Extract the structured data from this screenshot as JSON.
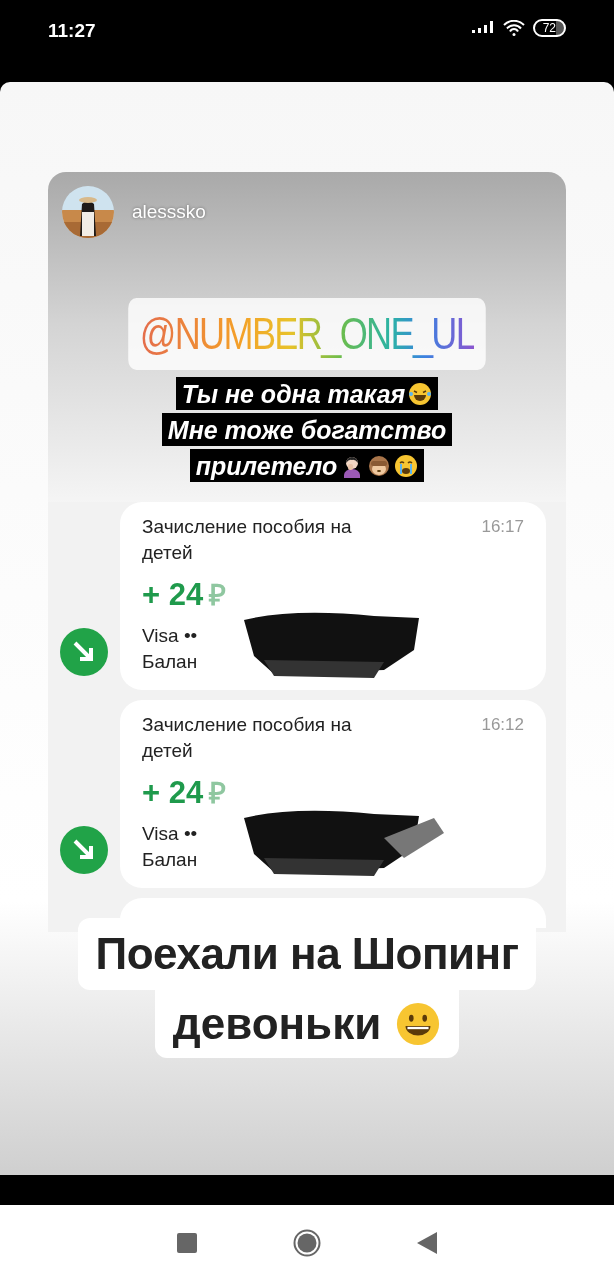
{
  "status_bar": {
    "time": "11:27",
    "battery": "72"
  },
  "story": {
    "username": "alesssko",
    "mention": "@NUMBER_ONE_UL",
    "caption_lines": [
      {
        "text": "Ты не одна такая",
        "emojis": [
          {
            "kind": "laugh"
          }
        ]
      },
      {
        "text": "Мне тоже богатство"
      },
      {
        "text": "прилетело",
        "emojis": [
          {
            "kind": "facepalm"
          },
          {
            "kind": "monkey"
          },
          {
            "kind": "cry"
          }
        ]
      }
    ],
    "transactions": [
      {
        "title": "Зачисление пособия на детей",
        "time": "16:17",
        "amount": "+ 24",
        "currency": "₽",
        "card": "Visa ••",
        "balance": "Балан"
      },
      {
        "title": "Зачисление пособия на детей",
        "time": "16:12",
        "amount": "+ 24",
        "currency": "₽",
        "card": "Visa ••",
        "balance": "Балан"
      }
    ],
    "bottom_lines": [
      "Поехали на Шопинг",
      "девоньки"
    ],
    "bottom_emoji": {
      "kind": "grin"
    }
  }
}
